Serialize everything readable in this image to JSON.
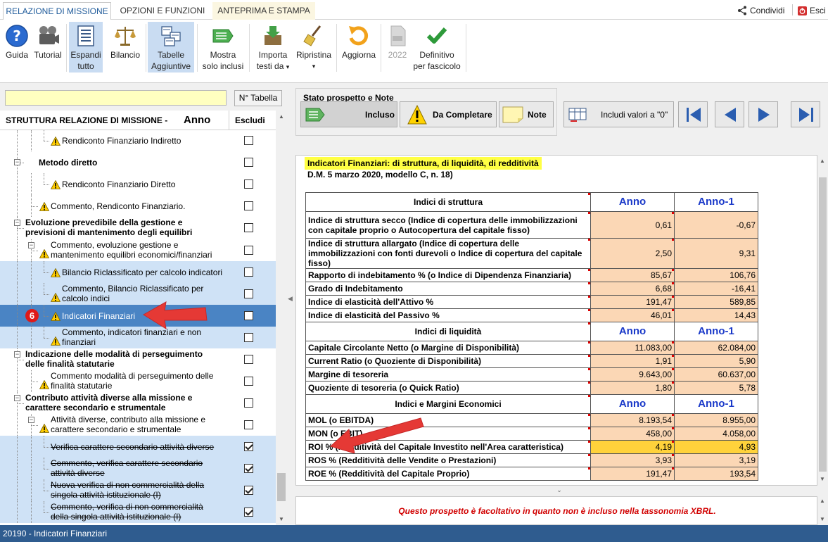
{
  "tabs": [
    {
      "label": "RELAZIONE DI MISSIONE",
      "active": true
    },
    {
      "label": "OPZIONI E FUNZIONI",
      "active": false
    },
    {
      "label": "ANTEPRIMA E STAMPA",
      "active": false
    }
  ],
  "top_right": {
    "share": "Condividi",
    "exit": "Esci"
  },
  "ribbon": {
    "guida": "Guida",
    "tutorial": "Tutorial",
    "espandi_1": "Espandi",
    "espandi_2": "tutto",
    "bilancio": "Bilancio",
    "tabelle_1": "Tabelle",
    "tabelle_2": "Aggiuntive",
    "mostra_1": "Mostra",
    "mostra_2": "solo inclusi",
    "importa_1": "Importa",
    "importa_2": "testi da",
    "ripristina": "Ripristina",
    "aggiorna": "Aggiorna",
    "anno_2022": "2022",
    "definitivo_1": "Definitivo",
    "definitivo_2": "per fascicolo",
    "dropdown_glyph": "▾"
  },
  "left": {
    "search_value": "",
    "ntab_label": "N° Tabella",
    "head_struttura": "STRUTTURA RELAZIONE DI MISSIONE -",
    "head_anno": "Anno",
    "head_escludi": "Escludi",
    "step_number": "6",
    "tree": [
      {
        "l1": "Rendiconto Finanziario Indiretto",
        "l2": "",
        "warn": true,
        "bold": false,
        "strike": false,
        "checked": false,
        "sel": false,
        "cur": false
      },
      {
        "l1": "Metodo diretto",
        "l2": "",
        "warn": false,
        "bold": true,
        "strike": false,
        "checked": false,
        "sel": false,
        "cur": false
      },
      {
        "l1": "Rendiconto Finanziario Diretto",
        "l2": "",
        "warn": true,
        "bold": false,
        "strike": false,
        "checked": false,
        "sel": false,
        "cur": false
      },
      {
        "l1": "Commento, Rendiconto Finanziario.",
        "l2": "",
        "warn": true,
        "bold": false,
        "strike": false,
        "checked": false,
        "sel": false,
        "cur": false
      },
      {
        "l1": "Evoluzione prevedibile della gestione e",
        "l2": "previsioni di mantenimento degli equilibri",
        "warn": false,
        "bold": true,
        "strike": false,
        "checked": false,
        "sel": false,
        "cur": false
      },
      {
        "l1": "Commento, evoluzione gestione e",
        "l2": "mantenimento equilibri economici/finanziari",
        "warn": true,
        "bold": false,
        "strike": false,
        "checked": false,
        "sel": false,
        "cur": false
      },
      {
        "l1": "Bilancio Riclassificato per calcolo indicatori",
        "l2": "",
        "warn": true,
        "bold": false,
        "strike": false,
        "checked": false,
        "sel": true,
        "cur": false
      },
      {
        "l1": "Commento, Bilancio Riclassificato per",
        "l2": "calcolo indici",
        "warn": true,
        "bold": false,
        "strike": false,
        "checked": false,
        "sel": true,
        "cur": false
      },
      {
        "l1": "Indicatori Finanziari",
        "l2": "",
        "warn": true,
        "bold": false,
        "strike": false,
        "checked": false,
        "sel": false,
        "cur": true
      },
      {
        "l1": "Commento, indicatori finanziari e non",
        "l2": "finanziari",
        "warn": true,
        "bold": false,
        "strike": false,
        "checked": false,
        "sel": true,
        "cur": false
      },
      {
        "l1": "Indicazione delle modalità di perseguimento",
        "l2": "delle finalità statutarie",
        "warn": false,
        "bold": true,
        "strike": false,
        "checked": false,
        "sel": false,
        "cur": false
      },
      {
        "l1": "Commento modalità di perseguimento delle",
        "l2": "finalità statutarie",
        "warn": true,
        "bold": false,
        "strike": false,
        "checked": false,
        "sel": false,
        "cur": false
      },
      {
        "l1": "Contributo attività diverse alla missione e",
        "l2": "carattere secondario e strumentale",
        "warn": false,
        "bold": true,
        "strike": false,
        "checked": false,
        "sel": false,
        "cur": false
      },
      {
        "l1": "Attività diverse, contributo alla missione e",
        "l2": "carattere secondario e strumentale",
        "warn": true,
        "bold": false,
        "strike": false,
        "checked": false,
        "sel": false,
        "cur": false
      },
      {
        "l1": "Verifica carattere secondario attività diverse",
        "l2": "",
        "warn": false,
        "bold": false,
        "strike": true,
        "checked": true,
        "sel": true,
        "cur": false
      },
      {
        "l1": "Commento, verifica carattere secondario",
        "l2": "attività diverse",
        "warn": false,
        "bold": false,
        "strike": true,
        "checked": true,
        "sel": true,
        "cur": false
      },
      {
        "l1": "Nuova verifica di non commercialità della",
        "l2": "singola attività istituzionale (I)",
        "warn": false,
        "bold": false,
        "strike": true,
        "checked": true,
        "sel": true,
        "cur": false
      },
      {
        "l1": "Commento, verifica di non commercialità",
        "l2": "della singola attività istituzionale (I)",
        "warn": false,
        "bold": false,
        "strike": true,
        "checked": true,
        "sel": true,
        "cur": false
      }
    ]
  },
  "right": {
    "stato_title": "Stato prospetto e Note",
    "incluso": "Incluso",
    "da_completare": "Da Completare",
    "note": "Note",
    "includi_valori": "Includi valori a \"0\"",
    "doc_title": "Indicatori Finanziari: di struttura, di liquidità, di redditività",
    "doc_sub": "D.M. 5 marzo 2020, modello C, n. 18)",
    "note_text": "Questo prospetto è facoltativo in quanto non è incluso nella tassonomia XBRL."
  },
  "table": {
    "col_anno": "Anno",
    "col_anno1": "Anno-1",
    "sections": [
      {
        "title": "Indici di struttura",
        "rows": [
          {
            "label": "Indice di struttura secco (Indice di copertura delle immobilizzazioni con capitale proprio o Autocopertura del capitale fisso)",
            "anno": "0,61",
            "anno1": "-0,67",
            "two": true,
            "hl": false
          },
          {
            "label": "Indice di struttura allargato (Indice di copertura delle immobilizzazioni con fonti durevoli o Indice di copertura del capitale fisso)",
            "anno": "2,50",
            "anno1": "9,31",
            "two": true,
            "hl": false
          },
          {
            "label": "Rapporto di indebitamento % (o Indice di Dipendenza Finanziaria)",
            "anno": "85,67",
            "anno1": "106,76",
            "two": false,
            "hl": false
          },
          {
            "label": "Grado di Indebitamento",
            "anno": "6,68",
            "anno1": "-16,41",
            "two": false,
            "hl": false
          },
          {
            "label": "Indice di elasticità dell'Attivo %",
            "anno": "191,47",
            "anno1": "589,85",
            "two": false,
            "hl": false
          },
          {
            "label": "Indice di elasticità del Passivo %",
            "anno": "46,01",
            "anno1": "14,43",
            "two": false,
            "hl": false
          }
        ]
      },
      {
        "title": "Indici di liquidità",
        "rows": [
          {
            "label": "Capitale Circolante Netto (o Margine di Disponibilità)",
            "anno": "11.083,00",
            "anno1": "62.084,00",
            "two": false,
            "hl": false
          },
          {
            "label": "Current Ratio (o Quoziente di Disponibilità)",
            "anno": "1,91",
            "anno1": "5,90",
            "two": false,
            "hl": false
          },
          {
            "label": "Margine di tesoreria",
            "anno": "9.643,00",
            "anno1": "60.637,00",
            "two": false,
            "hl": false
          },
          {
            "label": "Quoziente di tesoreria (o Quick Ratio)",
            "anno": "1,80",
            "anno1": "5,78",
            "two": false,
            "hl": false
          }
        ]
      },
      {
        "title": "Indici e Margini Economici",
        "rows": [
          {
            "label": "MOL (o EBITDA)",
            "anno": "8.193,54",
            "anno1": "8.955,00",
            "two": false,
            "hl": false
          },
          {
            "label": "MON (o EBIT)",
            "anno": "458,00",
            "anno1": "4.058,00",
            "two": false,
            "hl": false
          },
          {
            "label": "ROI % (Redditività del Capitale Investito nell'Area caratteristica)",
            "anno": "4,19",
            "anno1": "4,93",
            "two": false,
            "hl": true
          },
          {
            "label": "ROS % (Redditività delle Vendite o Prestazioni)",
            "anno": "3,93",
            "anno1": "3,19",
            "two": false,
            "hl": false
          },
          {
            "label": "ROE % (Redditività del Capitale Proprio)",
            "anno": "191,47",
            "anno1": "193,54",
            "two": false,
            "hl": false
          }
        ]
      }
    ]
  },
  "status_text": "20190 - Indicatori Finanziari",
  "colors": {
    "accent": "#1a39c9",
    "status_bar": "#2f5c8f",
    "selection": "#4a84c4",
    "value_cell": "#fbd7b5",
    "highlight": "#ffd23b",
    "arrow": "#e53935"
  }
}
